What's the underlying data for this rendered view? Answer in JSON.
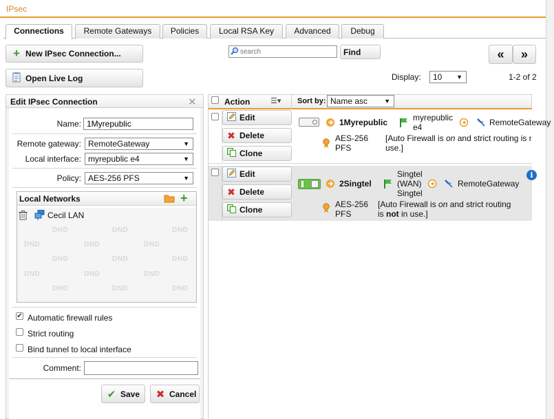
{
  "page": {
    "title": "IPsec"
  },
  "tabs": [
    {
      "label": "Connections"
    },
    {
      "label": "Remote Gateways"
    },
    {
      "label": "Policies"
    },
    {
      "label": "Local RSA Key"
    },
    {
      "label": "Advanced"
    },
    {
      "label": "Debug"
    }
  ],
  "toolbar": {
    "new_connection_label": "New IPsec Connection...",
    "open_live_log_label": "Open Live Log",
    "search_placeholder": "search",
    "find_label": "Find",
    "prev_label": "«",
    "next_label": "»",
    "display_label": "Display:",
    "display_value": "10",
    "range_text": "1-2 of 2"
  },
  "edit_panel": {
    "title": "Edit IPsec Connection",
    "name_label": "Name:",
    "name_value": "1Myrepublic",
    "remote_gateway_label": "Remote gateway:",
    "remote_gateway_value": "RemoteGateway",
    "local_interface_label": "Local interface:",
    "local_interface_value": "myrepublic e4",
    "policy_label": "Policy:",
    "policy_value": "AES-256 PFS",
    "local_networks_title": "Local Networks",
    "local_networks": [
      {
        "label": "Cecil LAN"
      }
    ],
    "dnd_label": "DND",
    "automatic_firewall_label": "Automatic firewall rules",
    "automatic_firewall_checked": true,
    "strict_routing_label": "Strict routing",
    "strict_routing_checked": false,
    "bind_tunnel_label": "Bind tunnel to local interface",
    "bind_tunnel_checked": false,
    "comment_label": "Comment:",
    "comment_value": "",
    "save_label": "Save",
    "cancel_label": "Cancel"
  },
  "table": {
    "action_header": "Action",
    "sort_label": "Sort by:",
    "sort_value": "Name asc",
    "row_buttons": {
      "edit": "Edit",
      "delete": "Delete",
      "clone": "Clone"
    },
    "rows": [
      {
        "name": "1Myrepublic",
        "enabled": false,
        "interface_line1": "myrepublic",
        "interface_line2": "e4",
        "gateway": "RemoteGateway",
        "policy_line1": "AES-256",
        "policy_line2": "PFS",
        "note_a": "[Auto Firewall is ",
        "note_on": "on",
        "note_b": " and strict routing is n",
        "note_c": "use.]"
      },
      {
        "name": "2Singtel",
        "enabled": true,
        "interface_line1": "Singtel",
        "interface_line2": "(WAN)",
        "interface_line3": "Singtel",
        "gateway": "RemoteGateway",
        "policy_line1": "AES-256",
        "policy_line2": "PFS",
        "note_a": "[Auto Firewall is ",
        "note_on": "on",
        "note_b": " and strict routing",
        "note_c1": "is ",
        "note_not": "not",
        "note_c2": " in use.]"
      }
    ]
  },
  "colors": {
    "accent": "#e99a2c",
    "title": "#d9822b",
    "enabled_green": "#6cc04a",
    "delete_red": "#c9302c"
  }
}
